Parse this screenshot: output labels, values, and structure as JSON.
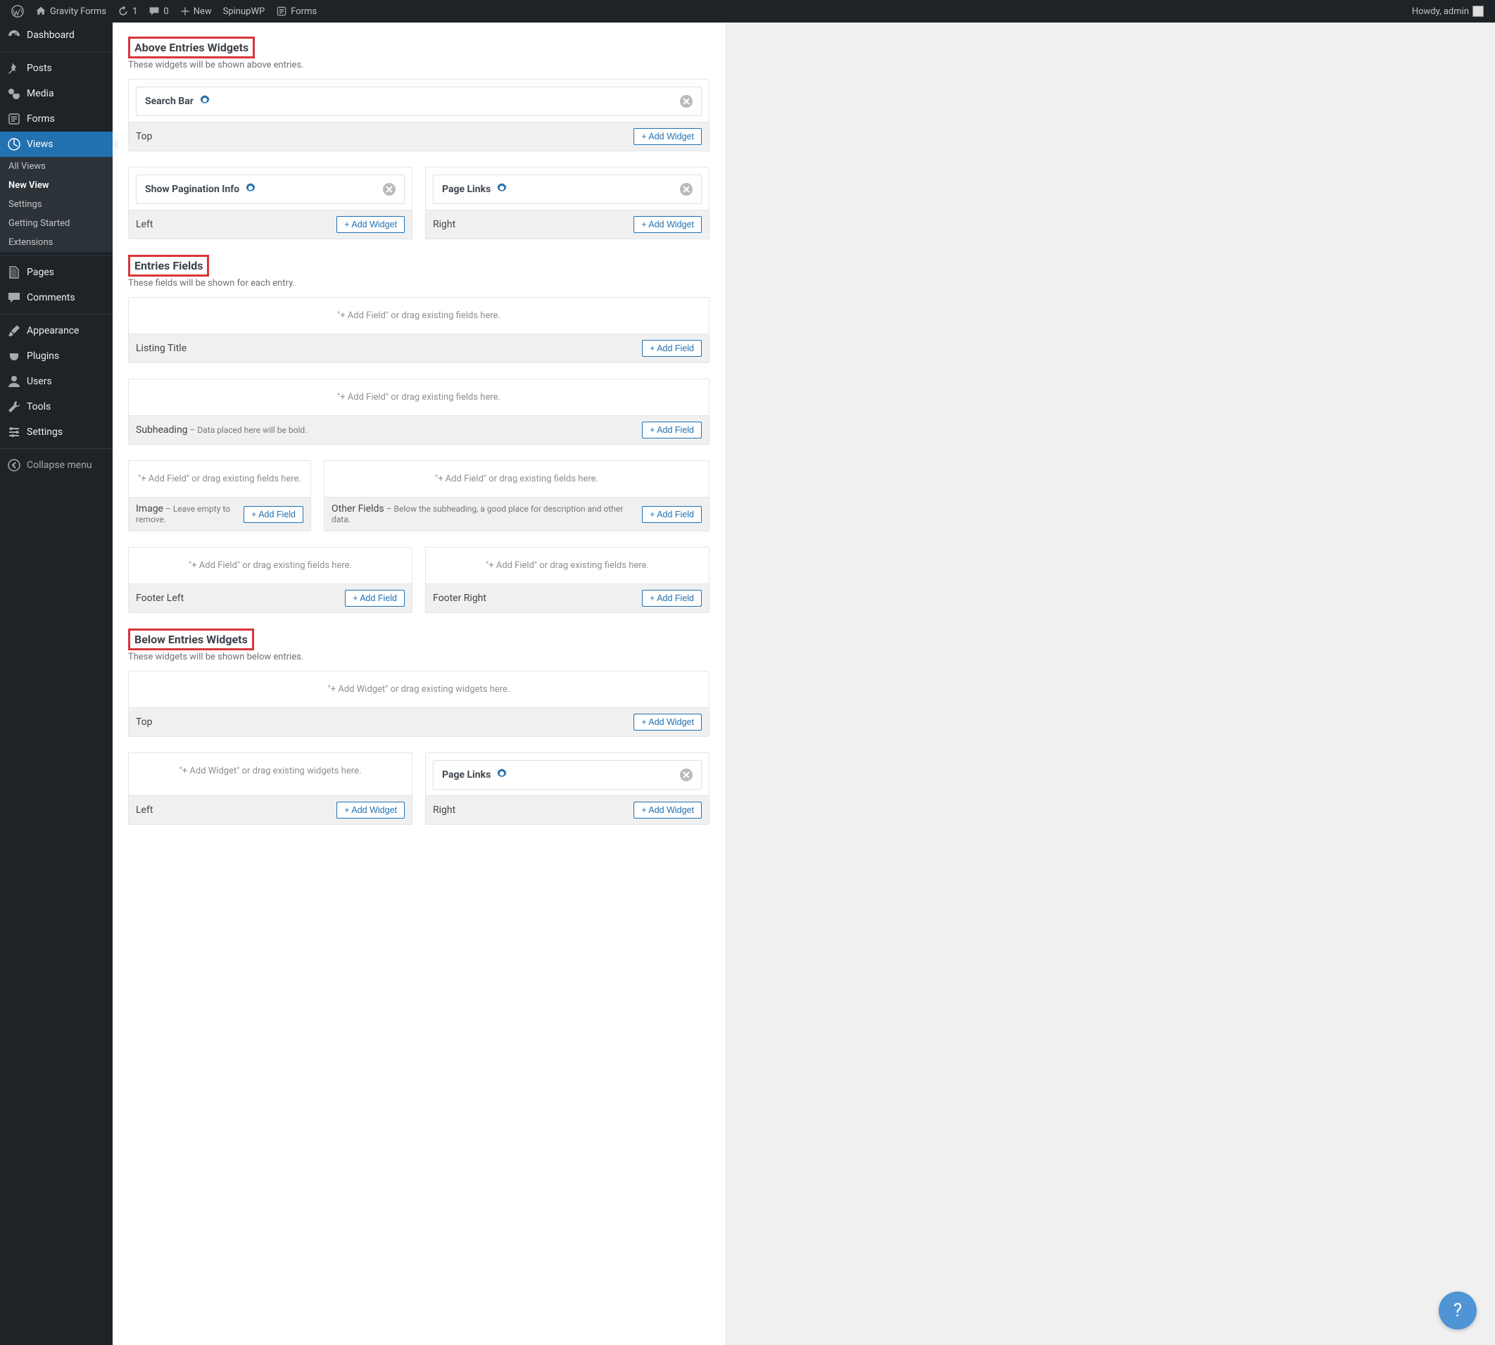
{
  "adminBar": {
    "site": "Gravity Forms",
    "updates": "1",
    "comments": "0",
    "new": "New",
    "spinup": "SpinupWP",
    "forms": "Forms",
    "greeting": "Howdy, admin"
  },
  "sidebar": {
    "items": [
      {
        "label": "Dashboard"
      },
      {
        "label": "Posts"
      },
      {
        "label": "Media"
      },
      {
        "label": "Forms"
      },
      {
        "label": "Views",
        "current": true
      },
      {
        "label": "Pages"
      },
      {
        "label": "Comments"
      },
      {
        "label": "Appearance"
      },
      {
        "label": "Plugins"
      },
      {
        "label": "Users"
      },
      {
        "label": "Tools"
      },
      {
        "label": "Settings"
      },
      {
        "label": "Collapse menu"
      }
    ],
    "submenu": [
      {
        "label": "All Views"
      },
      {
        "label": "New View",
        "current": true
      },
      {
        "label": "Settings"
      },
      {
        "label": "Getting Started"
      },
      {
        "label": "Extensions"
      }
    ]
  },
  "buttons": {
    "addWidget": "+ Add Widget",
    "addField": "+ Add Field"
  },
  "placeholders": {
    "field": "\"+ Add Field\" or drag existing fields here.",
    "widget": "\"+ Add Widget\" or drag existing widgets here."
  },
  "sections": {
    "above": {
      "title": "Above Entries Widgets",
      "desc": "These widgets will be shown above entries.",
      "top": {
        "label": "Top",
        "widgets": [
          {
            "title": "Search Bar"
          }
        ]
      },
      "left": {
        "label": "Left",
        "widgets": [
          {
            "title": "Show Pagination Info"
          }
        ]
      },
      "right": {
        "label": "Right",
        "widgets": [
          {
            "title": "Page Links"
          }
        ]
      }
    },
    "fields": {
      "title": "Entries Fields",
      "desc": "These fields will be shown for each entry.",
      "listingTitle": {
        "label": "Listing Title"
      },
      "subheading": {
        "label": "Subheading",
        "note": " – Data placed here will be bold."
      },
      "image": {
        "label": "Image",
        "note": " – Leave empty to remove."
      },
      "other": {
        "label": "Other Fields",
        "note": " – Below the subheading, a good place for description and other data."
      },
      "footerLeft": {
        "label": "Footer Left"
      },
      "footerRight": {
        "label": "Footer Right"
      }
    },
    "below": {
      "title": "Below Entries Widgets",
      "desc": "These widgets will be shown below entries.",
      "top": {
        "label": "Top"
      },
      "left": {
        "label": "Left"
      },
      "right": {
        "label": "Right",
        "widgets": [
          {
            "title": "Page Links"
          }
        ]
      }
    }
  },
  "help": "?"
}
